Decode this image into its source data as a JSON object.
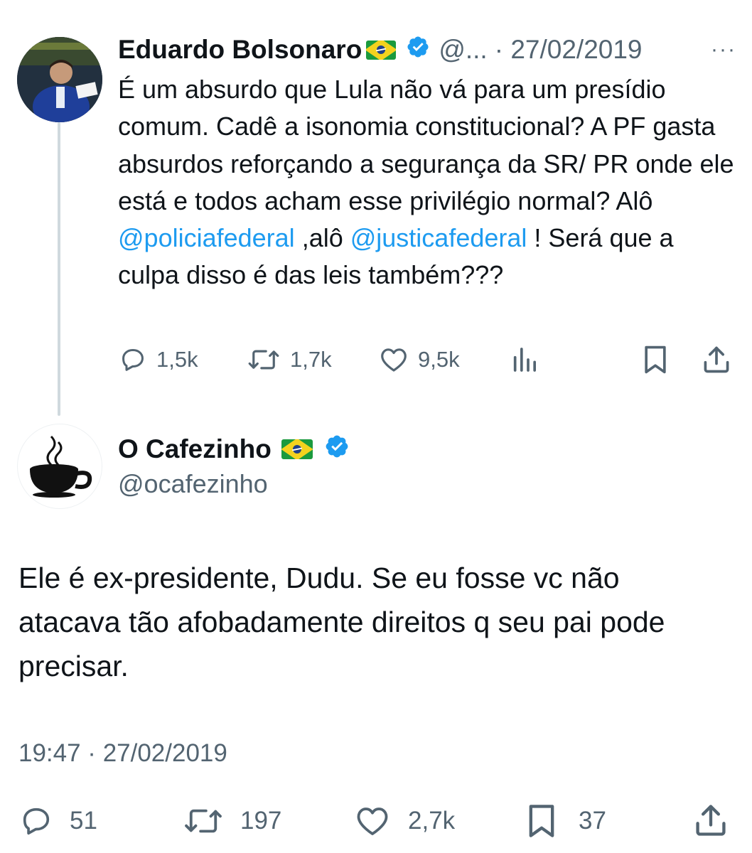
{
  "parent_tweet": {
    "author_name": "Eduardo Bolsonaro",
    "handle_truncated": "@...",
    "date": "· 27/02/2019",
    "more_label": "···",
    "text_part1": "É um absurdo que Lula não vá para um presídio comum. Cadê a isonomia constitucional? A PF gasta absurdos reforçando a segurança da SR/ PR onde ele está e todos acham esse privilégio normal? Alô",
    "mention1": "@policiafederal",
    "text_part2": " ,alô ",
    "mention2": "@justicafederal",
    "text_part3": " ! Será que a culpa disso é das leis também???",
    "replies": "1,5k",
    "retweets": "1,7k",
    "likes": "9,5k"
  },
  "main_tweet": {
    "author_name": "O Cafezinho",
    "handle": "@ocafezinho",
    "text": "Ele é ex-presidente, Dudu. Se eu fosse vc não atacava tão afobadamente direitos q seu pai pode precisar.",
    "timestamp": "19:47 · 27/02/2019",
    "replies": "51",
    "retweets": "197",
    "likes": "2,7k",
    "bookmarks": "37"
  },
  "icons": {
    "verified": "verified-badge-icon",
    "flag": "brazil-flag-icon",
    "reply": "reply-icon",
    "retweet": "retweet-icon",
    "like": "heart-icon",
    "views": "views-icon",
    "bookmark": "bookmark-icon",
    "share": "share-icon"
  },
  "colors": {
    "accent": "#1d9bf0",
    "text": "#0f1419",
    "muted": "#536471",
    "thread_line": "#cfd9de"
  }
}
